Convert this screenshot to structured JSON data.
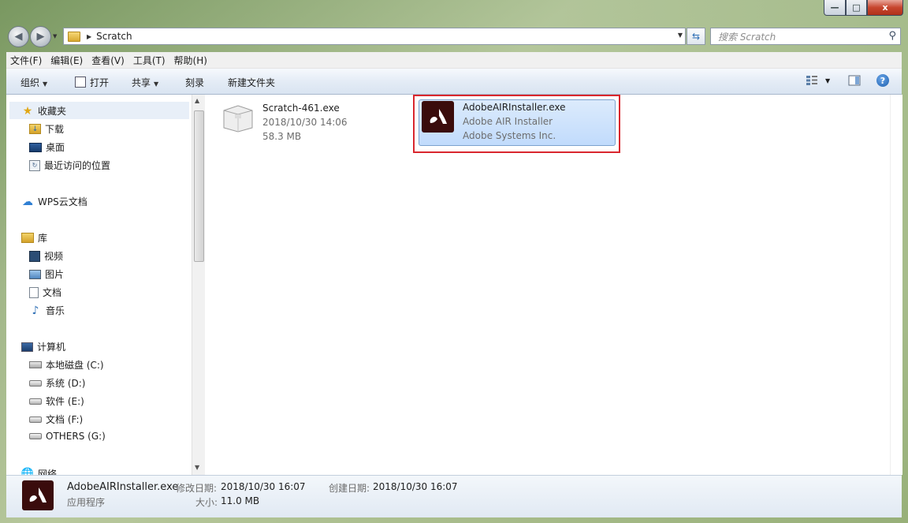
{
  "window": {
    "controls": {
      "minimize": "—",
      "maximize": "□",
      "close": "x"
    }
  },
  "address": {
    "path": "Scratch",
    "search_placeholder": "搜索 Scratch"
  },
  "menu": [
    "文件(F)",
    "编辑(E)",
    "查看(V)",
    "工具(T)",
    "帮助(H)"
  ],
  "commands": {
    "organize": "组织",
    "open": "打开",
    "share": "共享",
    "burn": "刻录",
    "new_folder": "新建文件夹"
  },
  "nav": {
    "favorites": "收藏夹",
    "downloads": "下载",
    "desktop": "桌面",
    "recent": "最近访问的位置",
    "wps": "WPS云文档",
    "library": "库",
    "videos": "视频",
    "pictures": "图片",
    "documents": "文档",
    "music": "音乐",
    "computer": "计算机",
    "drive_c": "本地磁盘 (C:)",
    "drive_d": "系统 (D:)",
    "drive_e": "软件 (E:)",
    "drive_f": "文档 (F:)",
    "drive_g": "OTHERS (G:)",
    "network": "网络"
  },
  "files": [
    {
      "name": "Scratch-461.exe",
      "line2": "2018/10/30 14:06",
      "line3": "58.3 MB",
      "icon": "package-icon"
    },
    {
      "name": "AdobeAIRInstaller.exe",
      "line2": "Adobe AIR Installer",
      "line3": "Adobe Systems Inc.",
      "icon": "adobe-air-icon"
    }
  ],
  "details": {
    "name": "AdobeAIRInstaller.exe",
    "type": "应用程序",
    "modified_label": "修改日期:",
    "modified_value": "2018/10/30 16:07",
    "created_label": "创建日期:",
    "created_value": "2018/10/30 16:07",
    "size_label": "大小:",
    "size_value": "11.0 MB"
  }
}
